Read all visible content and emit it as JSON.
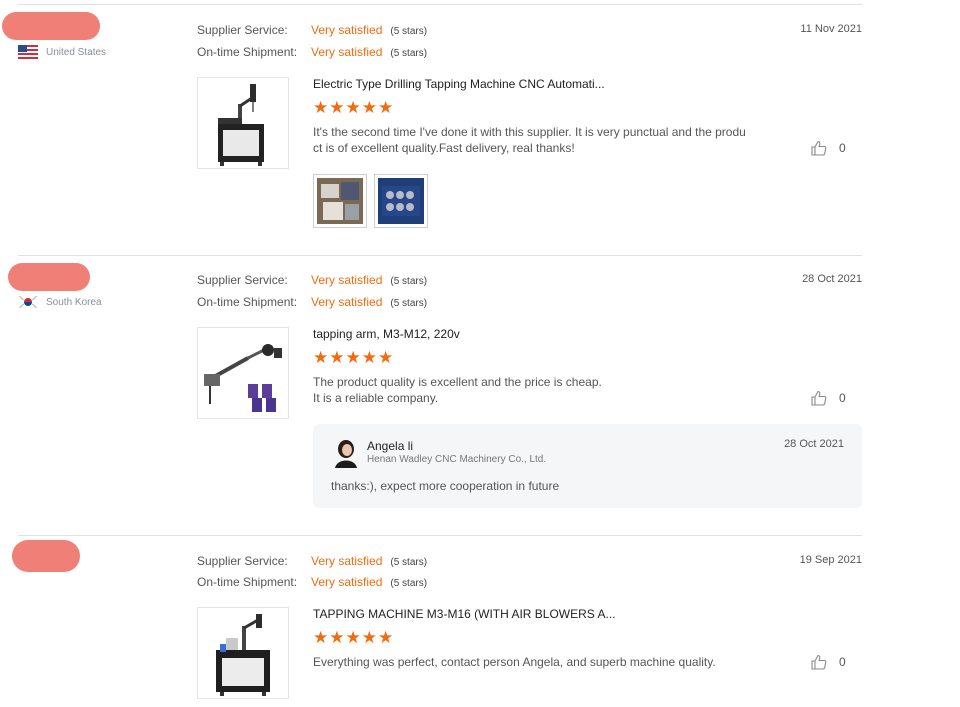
{
  "reviews": [
    {
      "country": "United States",
      "flag": "us-flag",
      "supplier_service_label": "Supplier Service:",
      "supplier_service_value": "Very satisfied",
      "supplier_service_stars": "(5 stars)",
      "ontime_label": "On-time Shipment:",
      "ontime_value": "Very satisfied",
      "ontime_stars": "(5 stars)",
      "date": "11 Nov 2021",
      "product_title": "Electric Type Drilling Tapping Machine CNC Automati...",
      "rating": 5,
      "text_line1": "It's the second time I've done it with this supplier. It is very punctual and the produ",
      "text_line2": "ct is of excellent quality.Fast delivery, real thanks!",
      "likes": "0",
      "photo_count": 2
    },
    {
      "country": "South Korea",
      "flag": "south-korea-flag",
      "supplier_service_label": "Supplier Service:",
      "supplier_service_value": "Very satisfied",
      "supplier_service_stars": "(5 stars)",
      "ontime_label": "On-time Shipment:",
      "ontime_value": "Very satisfied",
      "ontime_stars": "(5 stars)",
      "date": "28 Oct 2021",
      "product_title": "tapping arm, M3-M12, 220v",
      "rating": 5,
      "text_line1": "The product quality is excellent and the price is cheap.",
      "text_line2": "It is a reliable company.",
      "likes": "0",
      "reply": {
        "name": "Angela li",
        "company": "Henan Wadley CNC Machinery Co., Ltd.",
        "date": "28 Oct 2021",
        "text": "thanks:), expect more cooperation in future"
      }
    },
    {
      "country": "",
      "flag": "hidden-flag",
      "supplier_service_label": "Supplier Service:",
      "supplier_service_value": "Very satisfied",
      "supplier_service_stars": "(5 stars)",
      "ontime_label": "On-time Shipment:",
      "ontime_value": "Very satisfied",
      "ontime_stars": "(5 stars)",
      "date": "19 Sep 2021",
      "product_title": "TAPPING MACHINE M3-M16 (WITH AIR BLOWERS A...",
      "rating": 5,
      "text_line1": "Everything was perfect, contact person Angela, and superb machine quality.",
      "likes": "0"
    }
  ],
  "colors": {
    "accent": "#f26b10",
    "redaction": "#f08077",
    "divider": "#e2e2e2",
    "reply_bg": "#f5f6f8"
  }
}
